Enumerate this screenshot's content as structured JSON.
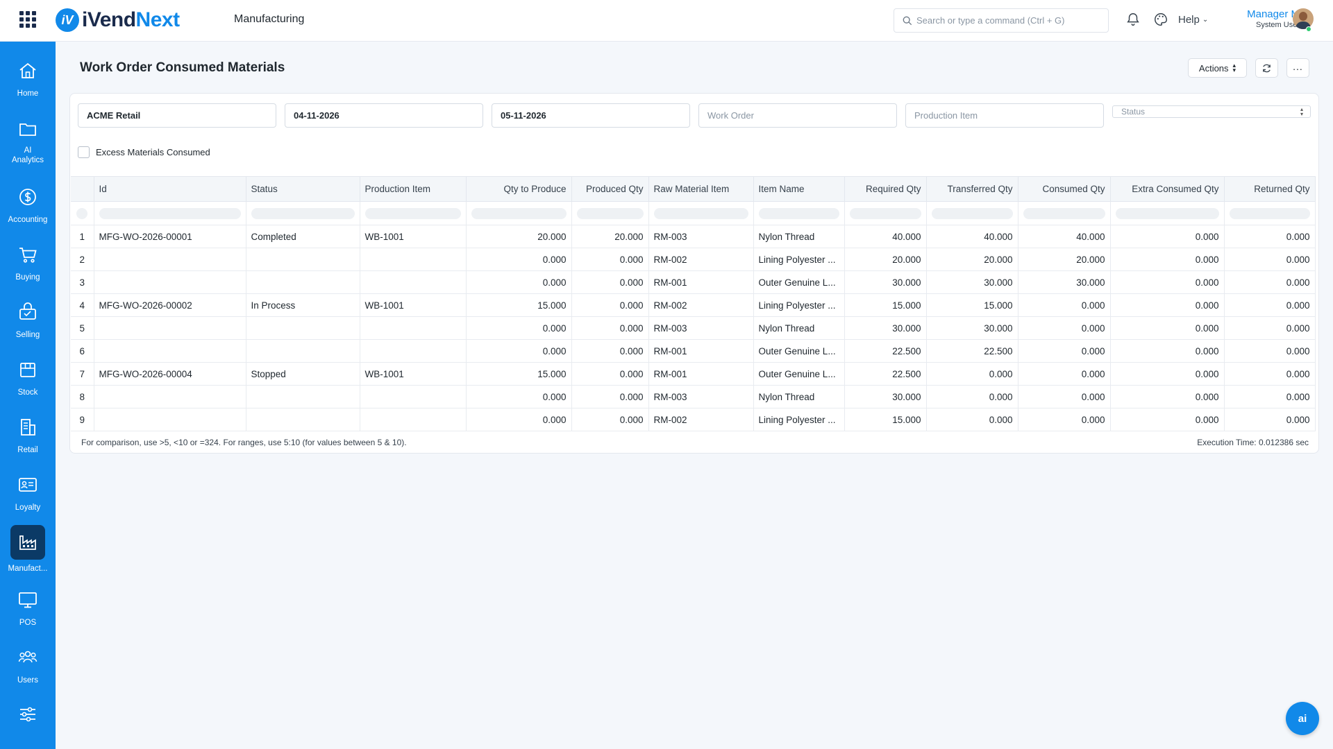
{
  "app": {
    "logo_part1": "iVend",
    "logo_part2": "Next",
    "logo_mark": "iV",
    "module": "Manufacturing"
  },
  "header": {
    "search_placeholder": "Search or type a command (Ctrl + G)",
    "help_label": "Help",
    "user_name": "Manager M",
    "user_role": "System User"
  },
  "sidebar": {
    "items": [
      {
        "label": "Home",
        "icon": "home-icon"
      },
      {
        "label": "AI Analytics",
        "icon": "folder-icon"
      },
      {
        "label": "Accounting",
        "icon": "dollar-icon"
      },
      {
        "label": "Buying",
        "icon": "cart-icon"
      },
      {
        "label": "Selling",
        "icon": "selling-icon"
      },
      {
        "label": "Stock",
        "icon": "box-icon"
      },
      {
        "label": "Retail",
        "icon": "retail-icon"
      },
      {
        "label": "Loyalty",
        "icon": "id-card-icon"
      },
      {
        "label": "Manufact...",
        "icon": "factory-icon"
      },
      {
        "label": "POS",
        "icon": "monitor-icon"
      },
      {
        "label": "Users",
        "icon": "users-icon"
      },
      {
        "label": "",
        "icon": "sliders-icon"
      }
    ]
  },
  "page": {
    "title": "Work Order Consumed Materials",
    "actions_label": "Actions",
    "more_label": "..."
  },
  "filters": {
    "company": "ACME Retail",
    "from_date": "04-11-2026",
    "to_date": "05-11-2026",
    "work_order_placeholder": "Work Order",
    "production_item_placeholder": "Production Item",
    "status_placeholder": "Status",
    "excess_label": "Excess Materials Consumed"
  },
  "table": {
    "columns": [
      "Id",
      "Status",
      "Production Item",
      "Qty to Produce",
      "Produced Qty",
      "Raw Material Item",
      "Item Name",
      "Required Qty",
      "Transferred Qty",
      "Consumed Qty",
      "Extra Consumed Qty",
      "Returned Qty"
    ],
    "rows": [
      [
        "1",
        "MFG-WO-2026-00001",
        "Completed",
        "WB-1001",
        "20.000",
        "20.000",
        "RM-003",
        "Nylon Thread",
        "40.000",
        "40.000",
        "40.000",
        "0.000",
        "0.000"
      ],
      [
        "2",
        "",
        "",
        "",
        "0.000",
        "0.000",
        "RM-002",
        "Lining Polyester ...",
        "20.000",
        "20.000",
        "20.000",
        "0.000",
        "0.000"
      ],
      [
        "3",
        "",
        "",
        "",
        "0.000",
        "0.000",
        "RM-001",
        "Outer Genuine L...",
        "30.000",
        "30.000",
        "30.000",
        "0.000",
        "0.000"
      ],
      [
        "4",
        "MFG-WO-2026-00002",
        "In Process",
        "WB-1001",
        "15.000",
        "0.000",
        "RM-002",
        "Lining Polyester ...",
        "15.000",
        "15.000",
        "0.000",
        "0.000",
        "0.000"
      ],
      [
        "5",
        "",
        "",
        "",
        "0.000",
        "0.000",
        "RM-003",
        "Nylon Thread",
        "30.000",
        "30.000",
        "0.000",
        "0.000",
        "0.000"
      ],
      [
        "6",
        "",
        "",
        "",
        "0.000",
        "0.000",
        "RM-001",
        "Outer Genuine L...",
        "22.500",
        "22.500",
        "0.000",
        "0.000",
        "0.000"
      ],
      [
        "7",
        "MFG-WO-2026-00004",
        "Stopped",
        "WB-1001",
        "15.000",
        "0.000",
        "RM-001",
        "Outer Genuine L...",
        "22.500",
        "0.000",
        "0.000",
        "0.000",
        "0.000"
      ],
      [
        "8",
        "",
        "",
        "",
        "0.000",
        "0.000",
        "RM-003",
        "Nylon Thread",
        "30.000",
        "0.000",
        "0.000",
        "0.000",
        "0.000"
      ],
      [
        "9",
        "",
        "",
        "",
        "0.000",
        "0.000",
        "RM-002",
        "Lining Polyester ...",
        "15.000",
        "0.000",
        "0.000",
        "0.000",
        "0.000"
      ]
    ],
    "footer_note": "For comparison, use >5, <10 or =324. For ranges, use 5:10 (for values between 5 & 10).",
    "execution_time": "Execution Time: 0.012386 sec"
  },
  "fab": {
    "label": "ai"
  },
  "colors": {
    "accent": "#1189e9",
    "sidebar_active": "#0b3a66"
  }
}
